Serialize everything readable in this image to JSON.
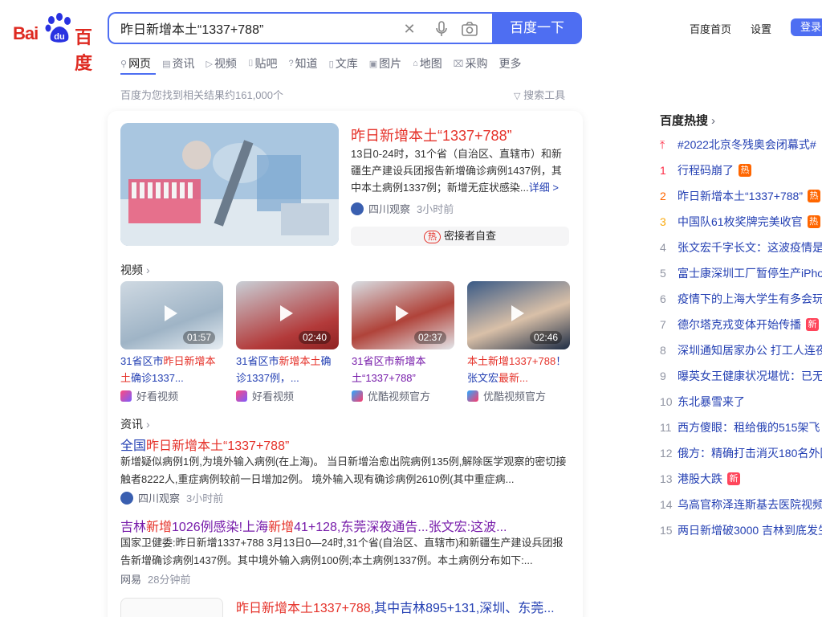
{
  "header": {
    "logo_bai": "Bai",
    "logo_du": "du",
    "logo_cn": "百度",
    "search_value": "昨日新增本土“1337+788”",
    "search_button": "百度一下",
    "links": [
      "百度首页",
      "设置"
    ],
    "login": "登录"
  },
  "tabs": [
    {
      "label": "网页",
      "icon": "search-icon"
    },
    {
      "label": "资讯",
      "icon": "news-icon"
    },
    {
      "label": "视频",
      "icon": "video-icon"
    },
    {
      "label": "贴吧",
      "icon": "tieba-icon"
    },
    {
      "label": "知道",
      "icon": "question-icon"
    },
    {
      "label": "文库",
      "icon": "doc-icon"
    },
    {
      "label": "图片",
      "icon": "image-icon"
    },
    {
      "label": "地图",
      "icon": "map-icon"
    },
    {
      "label": "采购",
      "icon": "purchase-icon"
    },
    {
      "label": "更多",
      "icon": ""
    }
  ],
  "result_count": "百度为您找到相关结果约161,000个",
  "search_tools": "搜索工具",
  "top_result": {
    "title": "昨日新增本土“1337+788”",
    "snippet": "13日0-24时，31个省（自治区、直辖市）和新疆生产建设兵团报告新增确诊病例1437例，其中本土病例1337例；新增无症状感染...",
    "more": "详细 >",
    "source": "四川观察",
    "time": "3小时前",
    "hot_badge": "热",
    "hot_chip": "密接者自查"
  },
  "video_section": {
    "label": "视频",
    "items": [
      {
        "title_a": "31省区市",
        "title_b": "昨日新增本土",
        "title_c": "确诊1337...",
        "duration": "01:57",
        "source": "好看视频",
        "visited": false
      },
      {
        "title_a": "31省区市",
        "title_b": "新增本土",
        "title_c": "确诊1337例，...",
        "duration": "02:40",
        "source": "好看视频",
        "visited": false
      },
      {
        "title_a": "31省区市",
        "title_b": "新增本土“13",
        "title_c": "37+788”",
        "duration": "02:37",
        "source": "优酷视频官方",
        "visited": true
      },
      {
        "title_a": "本土新增1337+788",
        "title_b": "！张文宏",
        "title_c": "最新...",
        "duration": "02:46",
        "source": "优酷视频官方",
        "visited": false
      }
    ]
  },
  "news_section": {
    "label": "资讯",
    "title_a": "全国",
    "title_b": "昨日新增本土“1337+788”",
    "snippet": "新增疑似病例1例,为境外输入病例(在上海)。 当日新增治愈出院病例135例,解除医学观察的密切接触者8222人,重症病例较前一日增加2例。 境外输入现有确诊病例2610例(其中重症病...",
    "source": "四川观察",
    "time": "3小时前"
  },
  "result2": {
    "title_parts": [
      "吉林",
      "新增",
      "1026例感染!上海",
      "新增",
      "41+128,东莞深夜通告...张文宏:这波..."
    ],
    "snippet": "国家卫健委:昨日新增1337+788 3月13日0—24时,31个省(自治区、直辖市)和新疆生产建设兵团报告新增确诊病例1437例。其中境外输入病例100例;本土病例1337例。本土病例分布如下:...",
    "source": "网易",
    "time": "28分钟前"
  },
  "result3": {
    "title_a": "昨日新增本土1337+788",
    "title_b": ",其中吉林895+131,深圳、东莞..."
  },
  "hot_list": {
    "header": "百度热搜",
    "items": [
      {
        "rank": "",
        "text": "#2022北京冬残奥会闭幕式#",
        "badge": "",
        "pinned": true
      },
      {
        "rank": "1",
        "text": "行程码崩了",
        "badge": "热"
      },
      {
        "rank": "2",
        "text": "昨日新增本土“1337+788”",
        "badge": "热"
      },
      {
        "rank": "3",
        "text": "中国队61枚奖牌完美收官",
        "badge": "热"
      },
      {
        "rank": "4",
        "text": "张文宏千字长文：这波疫情是",
        "badge": ""
      },
      {
        "rank": "5",
        "text": "富士康深圳工厂暂停生产iPho",
        "badge": ""
      },
      {
        "rank": "6",
        "text": "疫情下的上海大学生有多会玩",
        "badge": ""
      },
      {
        "rank": "7",
        "text": "德尔塔克戎变体开始传播",
        "badge": "新"
      },
      {
        "rank": "8",
        "text": "深圳通知居家办公 打工人连夜",
        "badge": ""
      },
      {
        "rank": "9",
        "text": "曝英女王健康状况堪忧：已无",
        "badge": ""
      },
      {
        "rank": "10",
        "text": "东北暴雪来了",
        "badge": ""
      },
      {
        "rank": "11",
        "text": "西方傻眼：租给俄的515架飞",
        "badge": ""
      },
      {
        "rank": "12",
        "text": "俄方：精确打击消灭180名外国",
        "badge": ""
      },
      {
        "rank": "13",
        "text": "港股大跌",
        "badge": "新"
      },
      {
        "rank": "14",
        "text": "乌高官称泽连斯基去医院视频",
        "badge": ""
      },
      {
        "rank": "15",
        "text": "两日新增破3000 吉林到底发生",
        "badge": ""
      }
    ]
  },
  "colors": {
    "accent": "#4e6ef2",
    "red": "#e5322a",
    "link": "#2440b3"
  }
}
